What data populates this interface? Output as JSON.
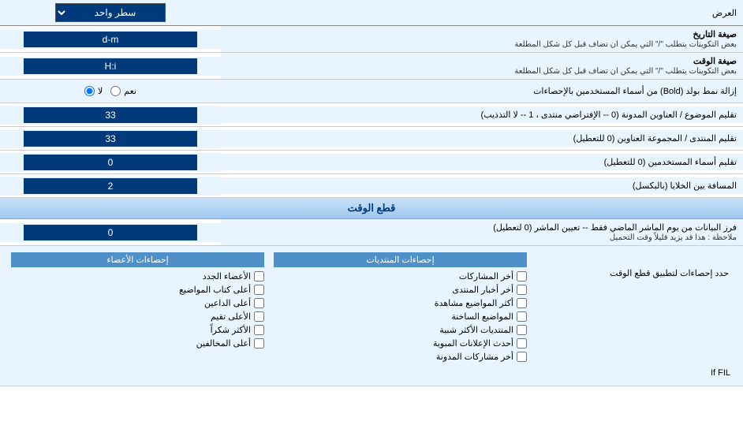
{
  "header": {
    "title": "العرض",
    "single_line_label": "سطر واحد"
  },
  "rows": [
    {
      "id": "date_format",
      "label": "صيغة التاريخ",
      "sublabel": "بعض التكوينات يتطلب \"/\" التي يمكن ان تضاف قبل كل شكل المطلعة",
      "value": "d-m"
    },
    {
      "id": "time_format",
      "label": "صيغة الوقت",
      "sublabel": "بعض التكوينات يتطلب \"/\" التي يمكن ان تضاف قبل كل شكل المطلعة",
      "value": "H:i"
    },
    {
      "id": "bold_remove",
      "label": "إزالة نمط بولد (Bold) من أسماء المستخدمين بالإحصاءات",
      "radio_yes": "نعم",
      "radio_no": "لا",
      "selected": "no"
    },
    {
      "id": "forum_subject",
      "label": "تقليم الموضوع / العناوين المدونة (0 -- الإفتراضي منتدى ، 1 -- لا التذذيب)",
      "value": "33"
    },
    {
      "id": "forum_group",
      "label": "تقليم المنتدى / المجموعة العناوين (0 للتعطيل)",
      "value": "33"
    },
    {
      "id": "user_names",
      "label": "تقليم أسماء المستخدمين (0 للتعطيل)",
      "value": "0"
    },
    {
      "id": "cell_spacing",
      "label": "المسافة بين الخلايا (بالبكسل)",
      "value": "2"
    }
  ],
  "realtime_section": {
    "title": "قطع الوقت",
    "note_label": "حدد إحصاءات لتطبيق قطع الوقت",
    "field": {
      "label": "فرز البيانات من يوم الماشر الماضي فقط -- تعيين الماشر (0 لتعطيل)",
      "note": "ملاحظة : هذا قد يزيد قليلاً وقت التحميل",
      "value": "0"
    }
  },
  "checkboxes": {
    "col1_header": "إحصاءات المنتديات",
    "col1_items": [
      "أخر المشاركات",
      "أخر أخبار المنتدى",
      "أكثر المواضيع مشاهدة",
      "المواضيع الساخنة",
      "المنتديات الأكثر شبية",
      "أحدث الإعلانات المبوية",
      "أخر مشاركات المدونة"
    ],
    "col2_header": "إحصاءات الأعضاء",
    "col2_items": [
      "الأعضاء الجدد",
      "أعلى كتاب المواضيع",
      "أعلى الداعين",
      "الأعلى تقيم",
      "الأكثر شكراً",
      "أعلى المخالفين"
    ]
  },
  "if_fil_text": "If FIL"
}
